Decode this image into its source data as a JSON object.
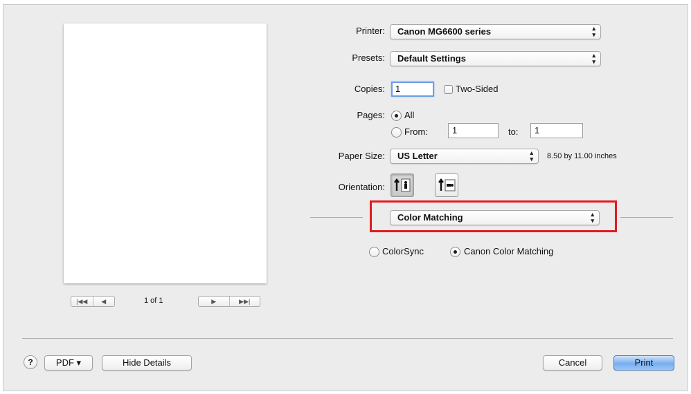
{
  "printer": {
    "label": "Printer:",
    "value": "Canon MG6600 series"
  },
  "presets": {
    "label": "Presets:",
    "value": "Default Settings"
  },
  "copies": {
    "label": "Copies:",
    "value": "1",
    "two_sided_label": "Two-Sided",
    "two_sided_checked": false
  },
  "pages": {
    "label": "Pages:",
    "all_label": "All",
    "from_label": "From:",
    "from_value": "1",
    "to_label": "to:",
    "to_value": "1",
    "selected": "All"
  },
  "paper_size": {
    "label": "Paper Size:",
    "value": "US Letter",
    "dimensions": "8.50 by 11.00 inches"
  },
  "orientation": {
    "label": "Orientation:",
    "selected": "portrait",
    "icons": [
      "portrait-orientation-icon",
      "landscape-orientation-icon"
    ]
  },
  "section_popup": {
    "value": "Color Matching"
  },
  "color_matching": {
    "options": [
      "ColorSync",
      "Canon Color Matching"
    ],
    "selected": "Canon Color Matching"
  },
  "preview": {
    "page_indicator": "1 of 1",
    "nav_first": "|◀◀",
    "nav_prev": "◀",
    "nav_next": "▶",
    "nav_last": "▶▶|"
  },
  "footer": {
    "help_label": "?",
    "pdf_label": "PDF ▾",
    "hide_details_label": "Hide Details",
    "cancel_label": "Cancel",
    "print_label": "Print"
  },
  "popup_arrow_glyph": "⌃⌄",
  "colors": {
    "highlight_box": "#e3191c",
    "default_button": "#77aef0",
    "dialog_bg": "#ececec"
  }
}
